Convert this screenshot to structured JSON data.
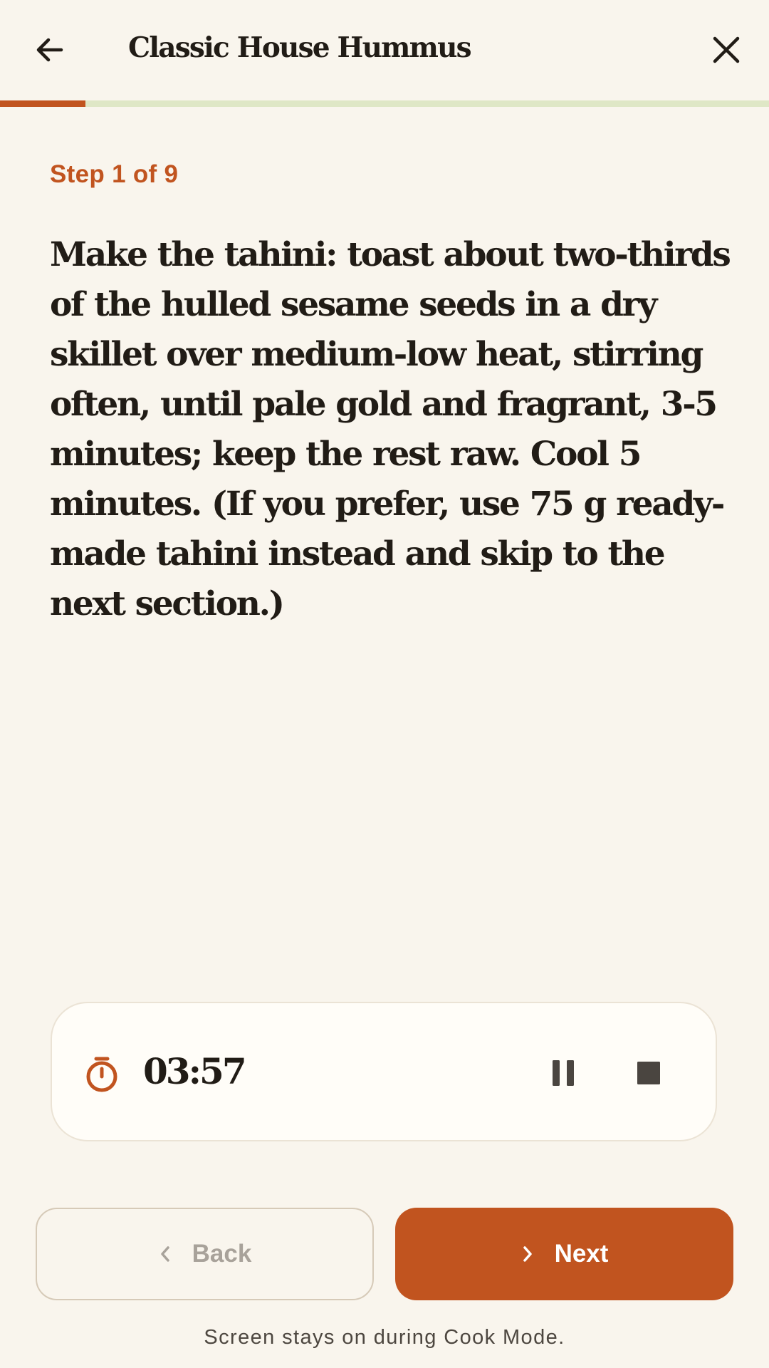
{
  "header": {
    "title": "Classic House Hummus",
    "back_icon": "arrow-left-icon",
    "close_icon": "close-icon"
  },
  "progress": {
    "current_step": 1,
    "total_steps": 9,
    "fraction": 0.111
  },
  "step": {
    "label": "Step 1 of 9",
    "instruction": "Make the tahini: toast about two-thirds of the hulled sesame seeds in a dry skillet over medium-low heat, stirring often, until pale gold and fragrant, 3-5 minutes; keep the rest raw. Cool 5 minutes. (If you prefer, use 75 g ready-made tahini instead and skip to the next section.)"
  },
  "timer": {
    "icon": "stopwatch-icon",
    "time": "03:57",
    "pause_icon": "pause-icon",
    "stop_icon": "stop-icon"
  },
  "navigation": {
    "back_label": "Back",
    "next_label": "Next",
    "back_icon": "chevron-left-icon",
    "next_icon": "chevron-right-icon"
  },
  "footer": {
    "note": "Screen stays on during Cook Mode."
  },
  "colors": {
    "accent": "#c1541f",
    "background": "#f9f5ed",
    "progress_track": "#dfe7c6",
    "text": "#211c16"
  }
}
